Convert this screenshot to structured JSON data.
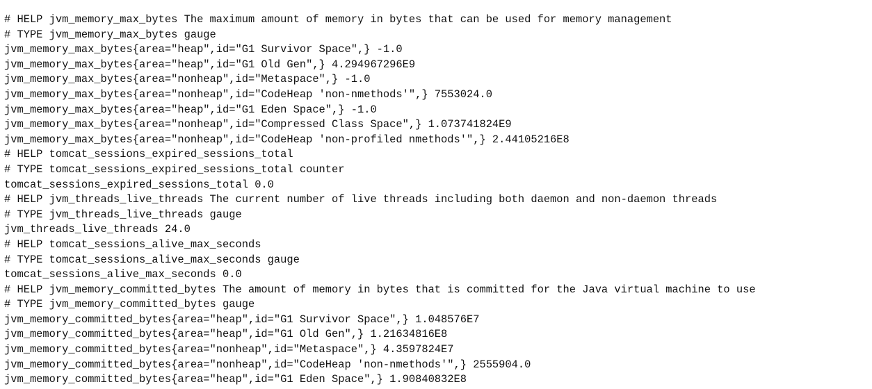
{
  "document": {
    "lines": [
      "# HELP jvm_memory_max_bytes The maximum amount of memory in bytes that can be used for memory management",
      "# TYPE jvm_memory_max_bytes gauge",
      "jvm_memory_max_bytes{area=\"heap\",id=\"G1 Survivor Space\",} -1.0",
      "jvm_memory_max_bytes{area=\"heap\",id=\"G1 Old Gen\",} 4.294967296E9",
      "jvm_memory_max_bytes{area=\"nonheap\",id=\"Metaspace\",} -1.0",
      "jvm_memory_max_bytes{area=\"nonheap\",id=\"CodeHeap 'non-nmethods'\",} 7553024.0",
      "jvm_memory_max_bytes{area=\"heap\",id=\"G1 Eden Space\",} -1.0",
      "jvm_memory_max_bytes{area=\"nonheap\",id=\"Compressed Class Space\",} 1.073741824E9",
      "jvm_memory_max_bytes{area=\"nonheap\",id=\"CodeHeap 'non-profiled nmethods'\",} 2.44105216E8",
      "# HELP tomcat_sessions_expired_sessions_total",
      "# TYPE tomcat_sessions_expired_sessions_total counter",
      "tomcat_sessions_expired_sessions_total 0.0",
      "# HELP jvm_threads_live_threads The current number of live threads including both daemon and non-daemon threads",
      "# TYPE jvm_threads_live_threads gauge",
      "jvm_threads_live_threads 24.0",
      "# HELP tomcat_sessions_alive_max_seconds",
      "# TYPE tomcat_sessions_alive_max_seconds gauge",
      "tomcat_sessions_alive_max_seconds 0.0",
      "# HELP jvm_memory_committed_bytes The amount of memory in bytes that is committed for the Java virtual machine to use",
      "# TYPE jvm_memory_committed_bytes gauge",
      "jvm_memory_committed_bytes{area=\"heap\",id=\"G1 Survivor Space\",} 1.048576E7",
      "jvm_memory_committed_bytes{area=\"heap\",id=\"G1 Old Gen\",} 1.21634816E8",
      "jvm_memory_committed_bytes{area=\"nonheap\",id=\"Metaspace\",} 4.3597824E7",
      "jvm_memory_committed_bytes{area=\"nonheap\",id=\"CodeHeap 'non-nmethods'\",} 2555904.0",
      "jvm_memory_committed_bytes{area=\"heap\",id=\"G1 Eden Space\",} 1.90840832E8"
    ]
  }
}
